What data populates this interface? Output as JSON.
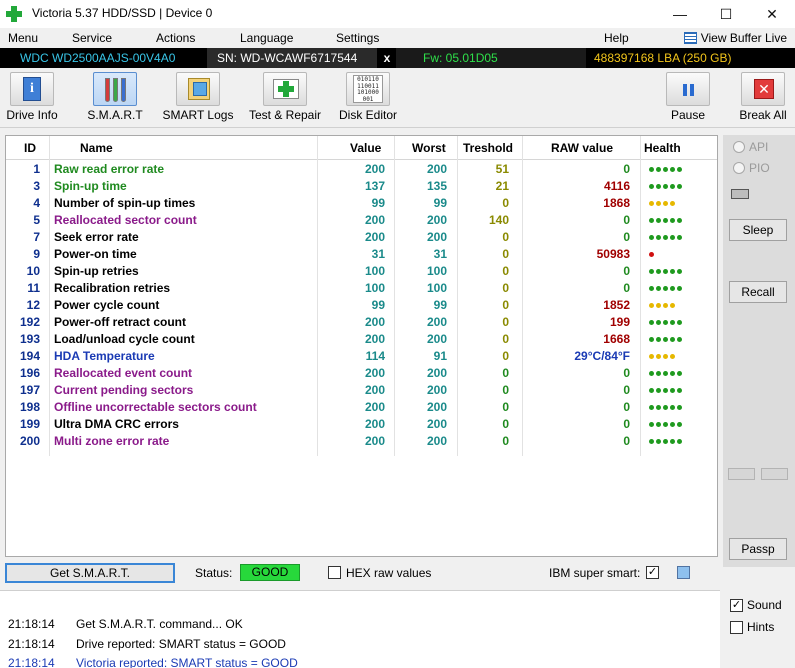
{
  "window": {
    "title": "Victoria 5.37 HDD/SSD | Device 0"
  },
  "menu": {
    "items": [
      "Menu",
      "Service",
      "Actions",
      "Language",
      "Settings",
      "Help"
    ],
    "buffer_live": "View Buffer Live"
  },
  "drive": {
    "model": "WDC WD2500AAJS-00V4A0",
    "serial": "SN: WD-WCAWF6717544",
    "close": "x",
    "firmware": "Fw: 05.01D05",
    "lba": "488397168 LBA (250 GB)"
  },
  "toolbar": {
    "drive_info": "Drive Info",
    "smart": "S.M.A.R.T",
    "smart_logs": "SMART Logs",
    "test_repair": "Test & Repair",
    "disk_editor": "Disk Editor",
    "disk_editor_bits": "010110\n110011\n101000\n001",
    "pause": "Pause",
    "break_all": "Break All"
  },
  "table": {
    "headers": {
      "id": "ID",
      "name": "Name",
      "value": "Value",
      "worst": "Worst",
      "threshold": "Treshold",
      "raw": "RAW value",
      "health": "Health"
    },
    "rows": [
      {
        "id": "1",
        "name": "Raw read error rate",
        "value": "200",
        "worst": "200",
        "threshold": "51",
        "raw": "0",
        "health": 5,
        "name_color": "#1f8a1f",
        "thr_color": "#8a8a00"
      },
      {
        "id": "3",
        "name": "Spin-up time",
        "value": "137",
        "worst": "135",
        "threshold": "21",
        "raw": "4116",
        "health": 5,
        "name_color": "#1f8a1f",
        "thr_color": "#8a8a00"
      },
      {
        "id": "4",
        "name": "Number of spin-up times",
        "value": "99",
        "worst": "99",
        "threshold": "0",
        "raw": "1868",
        "health": 4,
        "name_color": "#000000",
        "thr_color": "#8a8a00"
      },
      {
        "id": "5",
        "name": "Reallocated sector count",
        "value": "200",
        "worst": "200",
        "threshold": "140",
        "raw": "0",
        "health": 5,
        "name_color": "#8a1a8a",
        "thr_color": "#8a8a00"
      },
      {
        "id": "7",
        "name": "Seek error rate",
        "value": "200",
        "worst": "200",
        "threshold": "0",
        "raw": "0",
        "health": 5,
        "name_color": "#000000",
        "thr_color": "#8a8a00"
      },
      {
        "id": "9",
        "name": "Power-on time",
        "value": "31",
        "worst": "31",
        "threshold": "0",
        "raw": "50983",
        "health": 1,
        "name_color": "#000000",
        "thr_color": "#8a8a00"
      },
      {
        "id": "10",
        "name": "Spin-up retries",
        "value": "100",
        "worst": "100",
        "threshold": "0",
        "raw": "0",
        "health": 5,
        "name_color": "#000000",
        "thr_color": "#8a8a00"
      },
      {
        "id": "11",
        "name": "Recalibration retries",
        "value": "100",
        "worst": "100",
        "threshold": "0",
        "raw": "0",
        "health": 5,
        "name_color": "#000000",
        "thr_color": "#8a8a00"
      },
      {
        "id": "12",
        "name": "Power cycle count",
        "value": "99",
        "worst": "99",
        "threshold": "0",
        "raw": "1852",
        "health": 4,
        "name_color": "#000000",
        "thr_color": "#8a8a00"
      },
      {
        "id": "192",
        "name": "Power-off retract count",
        "value": "200",
        "worst": "200",
        "threshold": "0",
        "raw": "199",
        "health": 5,
        "name_color": "#000000",
        "thr_color": "#8a8a00"
      },
      {
        "id": "193",
        "name": "Load/unload cycle count",
        "value": "200",
        "worst": "200",
        "threshold": "0",
        "raw": "1668",
        "health": 5,
        "name_color": "#000000",
        "thr_color": "#8a8a00"
      },
      {
        "id": "194",
        "name": "HDA Temperature",
        "value": "114",
        "worst": "91",
        "threshold": "0",
        "raw": "29°C/84°F",
        "health": 4,
        "name_color": "#1a3ab4",
        "thr_color": "#8a8a00"
      },
      {
        "id": "196",
        "name": "Reallocated event count",
        "value": "200",
        "worst": "200",
        "threshold": "0",
        "raw": "0",
        "health": 5,
        "name_color": "#8a1a8a",
        "thr_color": "#1f8a1f"
      },
      {
        "id": "197",
        "name": "Current pending sectors",
        "value": "200",
        "worst": "200",
        "threshold": "0",
        "raw": "0",
        "health": 5,
        "name_color": "#8a1a8a",
        "thr_color": "#1f8a1f"
      },
      {
        "id": "198",
        "name": "Offline uncorrectable sectors count",
        "value": "200",
        "worst": "200",
        "threshold": "0",
        "raw": "0",
        "health": 5,
        "name_color": "#8a1a8a",
        "thr_color": "#1f8a1f"
      },
      {
        "id": "199",
        "name": "Ultra DMA CRC errors",
        "value": "200",
        "worst": "200",
        "threshold": "0",
        "raw": "0",
        "health": 5,
        "name_color": "#000000",
        "thr_color": "#1f8a1f"
      },
      {
        "id": "200",
        "name": "Multi zone error rate",
        "value": "200",
        "worst": "200",
        "threshold": "0",
        "raw": "0",
        "health": 5,
        "name_color": "#8a1a8a",
        "thr_color": "#1f8a1f"
      }
    ]
  },
  "side": {
    "api": "API",
    "pio": "PIO",
    "sleep": "Sleep",
    "recall": "Recall",
    "passp": "Passp"
  },
  "controls": {
    "get_smart": "Get S.M.A.R.T.",
    "status_label": "Status:",
    "status_value": "GOOD",
    "hex_raw": "HEX raw values",
    "ibm": "IBM super smart:",
    "ibm_checked": "✓"
  },
  "log": [
    {
      "time": "21:18:14",
      "text": "Get S.M.A.R.T. command... OK",
      "color": "#000000"
    },
    {
      "time": "21:18:14",
      "text": "Drive reported: SMART status = GOOD",
      "color": "#000000"
    },
    {
      "time": "21:18:14",
      "text": "Victoria reported: SMART status = GOOD",
      "color": "#1a3ab4"
    }
  ],
  "options": {
    "sound": "Sound",
    "sound_checked": "✓",
    "hints": "Hints"
  },
  "colors": {
    "value_teal": "#1a8a8a",
    "raw_red": "#a00000",
    "raw_zero": "#1f8a1f",
    "raw_temp": "#1a3ab4",
    "dot_green": "#1f9a1f",
    "dot_yellow": "#e6b800",
    "dot_red": "#d01010"
  }
}
